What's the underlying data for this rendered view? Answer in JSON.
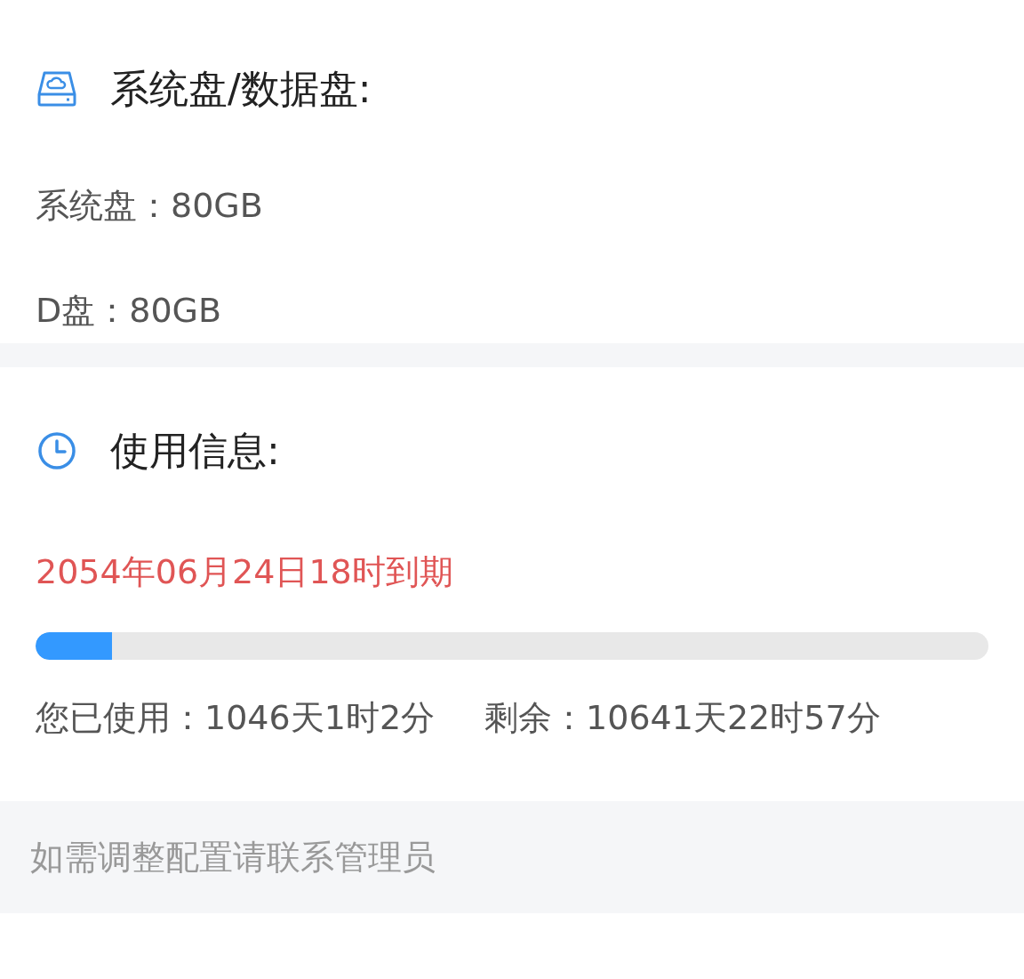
{
  "disk_section": {
    "title": "系统盘/数据盘:",
    "lines": [
      "系统盘：80GB",
      "D盘：80GB"
    ]
  },
  "usage_section": {
    "title": "使用信息:",
    "expiry": "2054年06月24日18时到期",
    "progress": {
      "level": 0.08
    },
    "used": "您已使用：1046天1时2分",
    "remaining": "剩余：10641天22时57分"
  },
  "footer": {
    "note": "如需调整配置请联系管理员"
  }
}
